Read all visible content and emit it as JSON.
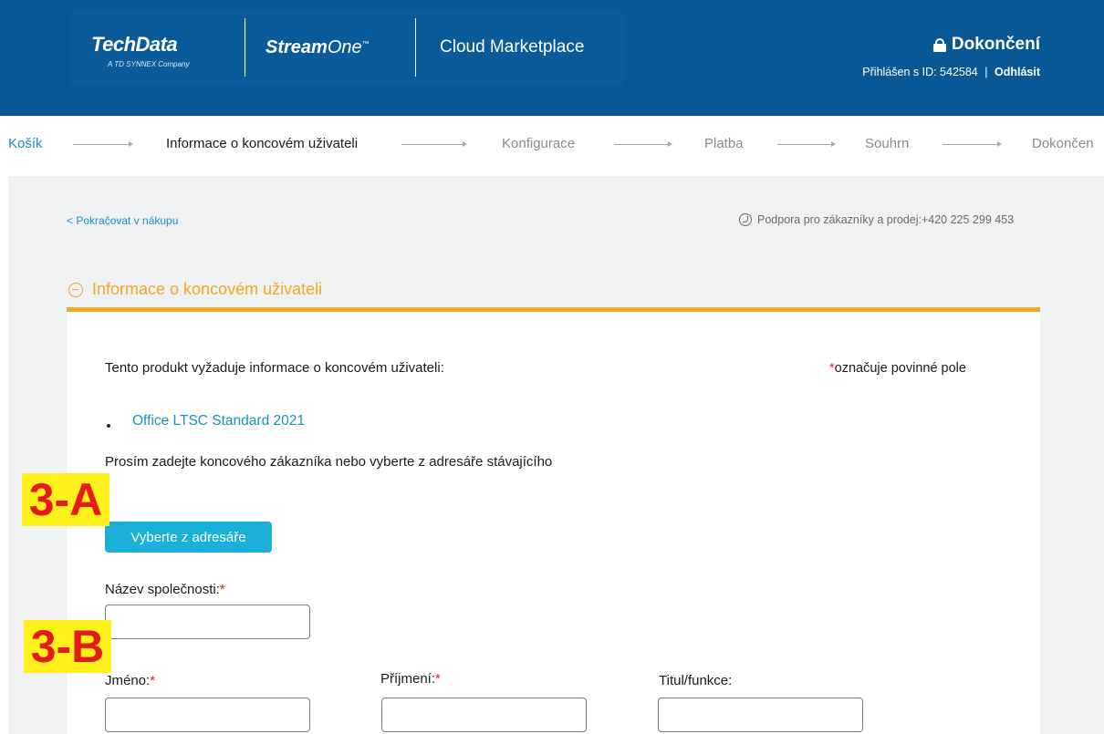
{
  "header": {
    "logo_text": "TechData",
    "logo_subtitle": "A TD SYNNEX Company",
    "product_bold": "Stream",
    "product_rest": "One",
    "product_tm": "™",
    "marketplace": "Cloud Marketplace",
    "status_title": "Dokončení",
    "login_text": "Přihlášen s ID: 542584",
    "separator": "|",
    "logout_label": "Odhlásit",
    "colors": {
      "header_bg": "#0a5796",
      "accent": "#f5a623",
      "link": "#1a8fc2",
      "button": "#1ab0d8"
    }
  },
  "steps": {
    "cart": "Košík",
    "end_user_info": "Informace o koncovém uživateli",
    "configuration": "Konfigurace",
    "payment": "Platba",
    "summary": "Souhrn",
    "completion": "Dokončen"
  },
  "top_links": {
    "continue_shopping": "< Pokračovat v nákupu",
    "support": "Podpora pro zákazníky a prodej:+420 225 299 453"
  },
  "section": {
    "title": "Informace o koncovém uživateli"
  },
  "form": {
    "intro": "Tento produkt vyžaduje informace o koncovém uživateli:",
    "required_star": "*",
    "required_note": "označuje povinné pole",
    "product_name": "Office LTSC Standard 2021",
    "prompt": "Prosím zadejte koncového zákazníka nebo vyberte z adresáře stávajícího",
    "directory_button": "Vyberte z adresáře",
    "company_label": "Název společnosti:",
    "first_name_label": "Jméno:",
    "last_name_label": "Příjmení:",
    "title_label": "Titul/funkce:",
    "company_value": "",
    "first_name_value": "",
    "last_name_value": "",
    "title_value": ""
  },
  "annotations": {
    "a": "3-A",
    "b": "3-B"
  }
}
